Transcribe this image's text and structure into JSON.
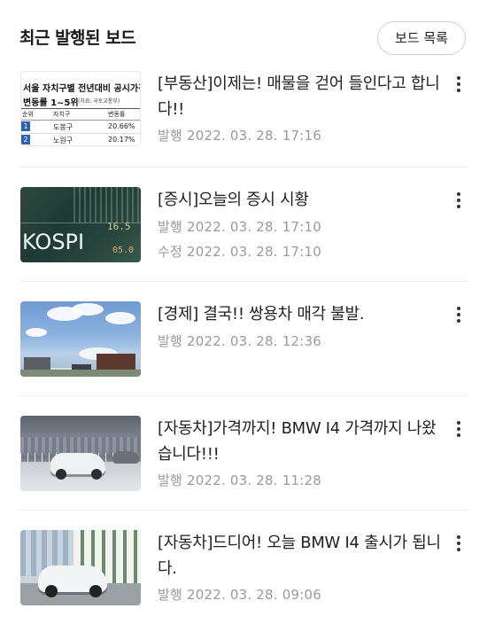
{
  "header": {
    "title": "최근 발행된 보드",
    "board_list_label": "보드 목록"
  },
  "articles": [
    {
      "title": "[부동산]이제는! 매물을 걷어 들인다고 합니다!!",
      "published": "발행 2022. 03. 28. 17:16",
      "thumb": {
        "line1": "서울 자치구별 전년대비 공시가격",
        "line2": "변동률 1~5위",
        "source": "(자료: 국토교통부)",
        "col_rank": "순위",
        "col_district": "자치구",
        "col_rate": "변동률",
        "rows": [
          {
            "rank": "1",
            "district": "도봉구",
            "rate": "20.66%"
          },
          {
            "rank": "2",
            "district": "노원구",
            "rate": "20.17%"
          }
        ]
      }
    },
    {
      "title": "[증시]오늘의 증시 시황",
      "published": "발행 2022. 03. 28. 17:10",
      "modified": "수정 2022. 03. 28. 17:10",
      "thumb": {
        "text": "KOSPI",
        "digits_top": "16.5",
        "digits_bottom": "05.0"
      }
    },
    {
      "title": "[경제] 결국!! 쌍용차 매각 불발.",
      "published": "발행 2022. 03. 28. 12:36"
    },
    {
      "title": "[자동차]가격까지! BMW I4 가격까지 나왔습니다!!!",
      "published": "발행 2022. 03. 28. 11:28"
    },
    {
      "title": "[자동차]드디어! 오늘 BMW I4 출시가 됩니다.",
      "published": "발행 2022. 03. 28. 09:06"
    }
  ]
}
